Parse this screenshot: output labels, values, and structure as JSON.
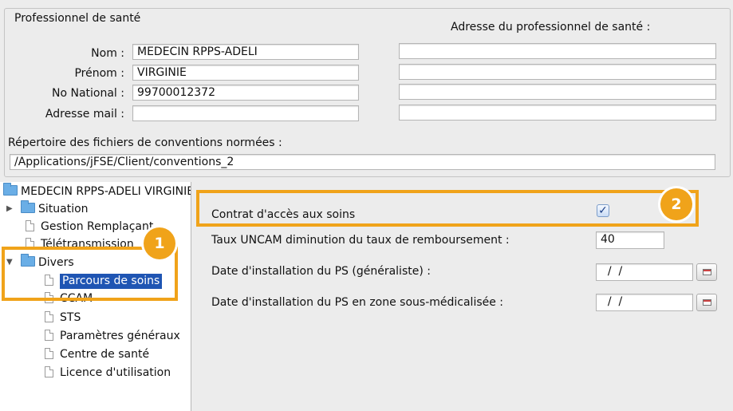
{
  "group": {
    "title": "Professionnel de santé",
    "address_header": "Adresse du professionnel de santé :"
  },
  "fields": {
    "nom": {
      "label": "Nom :",
      "value": "MEDECIN RPPS-ADELI"
    },
    "prenom": {
      "label": "Prénom :",
      "value": "VIRGINIE"
    },
    "no_national": {
      "label": "No National :",
      "value": "99700012372"
    },
    "email": {
      "label": "Adresse mail :",
      "value": ""
    },
    "address_lines": [
      "",
      "",
      "",
      ""
    ]
  },
  "conventions": {
    "label": "Répertoire des fichiers de conventions normées :",
    "value": "/Applications/jFSE/Client/conventions_2"
  },
  "tree": {
    "root": "MEDECIN RPPS-ADELI VIRGINIE",
    "items": [
      {
        "label": "Situation",
        "kind": "folder",
        "expanded": false
      },
      {
        "label": "Gestion Remplaçant",
        "kind": "doc"
      },
      {
        "label": "Télétransmission",
        "kind": "doc"
      },
      {
        "label": "Divers",
        "kind": "folder",
        "expanded": true
      },
      {
        "label": "Parcours de soins",
        "kind": "doc",
        "selected": true
      },
      {
        "label": "CCAM",
        "kind": "doc"
      },
      {
        "label": "STS",
        "kind": "doc"
      },
      {
        "label": "Paramètres généraux",
        "kind": "doc"
      },
      {
        "label": "Centre de santé",
        "kind": "doc"
      },
      {
        "label": "Licence d'utilisation",
        "kind": "doc"
      }
    ]
  },
  "settings": {
    "contrat": {
      "label": "Contrat d'accès aux soins",
      "checked": true
    },
    "taux": {
      "label": "Taux UNCAM diminution du taux de remboursement :",
      "value": "40"
    },
    "date_install": {
      "label": "Date d'installation du PS (généraliste) :",
      "value": "  /  /"
    },
    "date_install_zone": {
      "label": "Date d'installation du PS en zone sous-médicalisée :",
      "value": "  /  /"
    }
  },
  "callouts": {
    "one": "1",
    "two": "2"
  },
  "colors": {
    "accent": "#f0a31a",
    "selection": "#1f55b3",
    "folder": "#6aaee6"
  }
}
